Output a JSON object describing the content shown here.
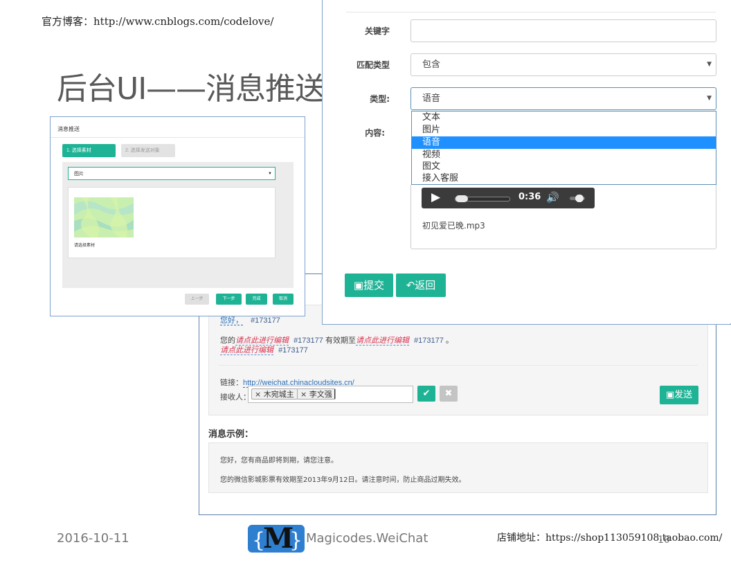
{
  "slide": {
    "blog_line": "官方博客：http://www.cnblogs.com/codelove/",
    "title": "后台UI——消息推送",
    "date": "2016-10-11",
    "brand_logo": "M",
    "brand_name": "Magicodes.WeiChat",
    "shop_line": "店铺地址：https://shop113059108.taobao.com/",
    "page_number": "10"
  },
  "mini_screenshot": {
    "title": "消息推送",
    "step1": "1. 选择素材",
    "step2": "2. 选择发送对象",
    "select_value": "图片",
    "card_caption": "请选择素材",
    "buttons": {
      "prev": "上一步",
      "next": "下一步",
      "done": "完成",
      "cancel": "取消"
    }
  },
  "form": {
    "keyword_label": "关键字",
    "keyword_value": "",
    "match_label": "匹配类型",
    "match_value": "包含",
    "type_label": "类型:",
    "type_value": "语音",
    "content_label": "内容:",
    "type_options": [
      "文本",
      "图片",
      "语音",
      "视频",
      "图文",
      "接入客服"
    ],
    "selected_option": "语音",
    "audio_time": "0:36",
    "audio_file": "初见爱已晚.mp3",
    "submit_label": "提交",
    "back_label": "返回"
  },
  "message_panel": {
    "line0_a": "您好，",
    "line0_b": "#173177",
    "line1_a": "您的",
    "line1_b": "请点此进行编辑",
    "line1_c": "#173177",
    "line1_d": "有效期至",
    "line1_e": "请点此进行编辑",
    "line1_f": "#173177",
    "line1_g": "。",
    "line2_a": "请点此进行编辑",
    "line2_b": "#173177",
    "link_label": "链接：",
    "link_url": "http://weichat.chinacloudsites.cn/",
    "receiver_label": "接收人：",
    "receivers": [
      "木宛城主",
      "李文强"
    ],
    "send_label": "发送",
    "example_title": "消息示例：",
    "example_line1": "您好，您有商品即将到期，请您注意。",
    "example_line2": "您的微信影城影票有效期至2013年9月12日。请注意时间，防止商品过期失效。"
  }
}
